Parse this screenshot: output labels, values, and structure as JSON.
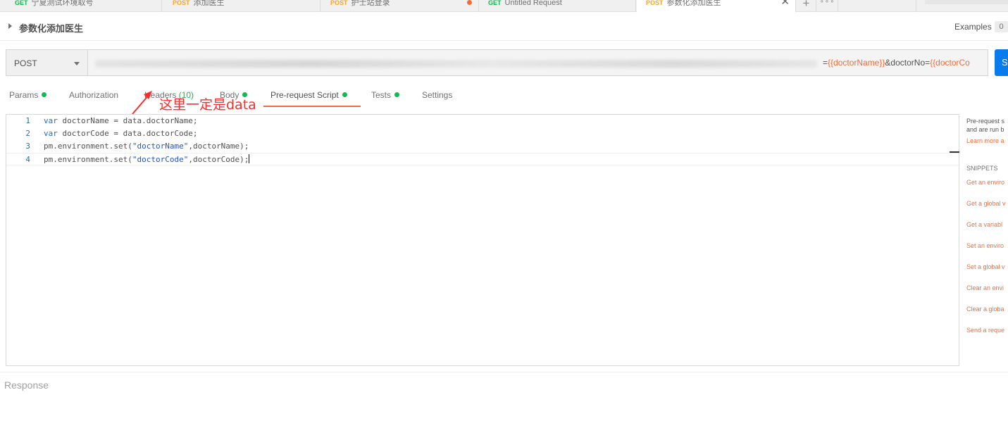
{
  "tabs": [
    {
      "method": "GET",
      "name": "宁夏测试环境取号"
    },
    {
      "method": "POST",
      "name": "添加医生"
    },
    {
      "method": "POST",
      "name": "护士站登录"
    },
    {
      "method": "GET",
      "name": "Untitled Request"
    },
    {
      "method": "POST",
      "name": "参数化添加医生"
    }
  ],
  "request": {
    "title": "参数化添加医生",
    "examples_label": "Examples",
    "examples_count": "0",
    "method": "POST",
    "url_param1_prefix": "=",
    "url_var1": "{{doctorName}}",
    "url_param2": "&doctorNo=",
    "url_var2": "{{doctorCo"
  },
  "subtabs": {
    "params": "Params",
    "authorization": "Authorization",
    "headers": "Headers",
    "headers_count": "(10)",
    "body": "Body",
    "prerequest": "Pre-request Script",
    "tests": "Tests",
    "settings": "Settings"
  },
  "annotation": {
    "text": "这里一定是data"
  },
  "editor": {
    "lines": [
      {
        "num": "1",
        "kw": "var",
        "rest": " doctorName = data.doctorName;"
      },
      {
        "num": "2",
        "kw": "var",
        "rest": " doctorCode = data.doctorCode;"
      },
      {
        "num": "3",
        "pre": "pm.environment.set(",
        "str": "\"doctorName\"",
        "post": ",doctorName);"
      },
      {
        "num": "4",
        "pre": "pm.environment.set(",
        "str": "\"doctorCode\"",
        "post": ",doctorCode);"
      }
    ]
  },
  "snippets": {
    "desc1": "Pre-request s",
    "desc2": "and are run b",
    "learn": "Learn more a",
    "heading": "SNIPPETS",
    "items": [
      "Get an enviro",
      "Get a global v",
      "Get a variabl",
      "Set an enviro",
      "Set a global v",
      "Clear an envi",
      "Clear a globa",
      "Send a reque"
    ]
  },
  "response": {
    "label": "Response"
  },
  "colors": {
    "accent": "#f26b3a",
    "get": "#0cbb52",
    "post": "#f5a623",
    "send": "#097bed",
    "annotation": "#ff2a2a"
  }
}
